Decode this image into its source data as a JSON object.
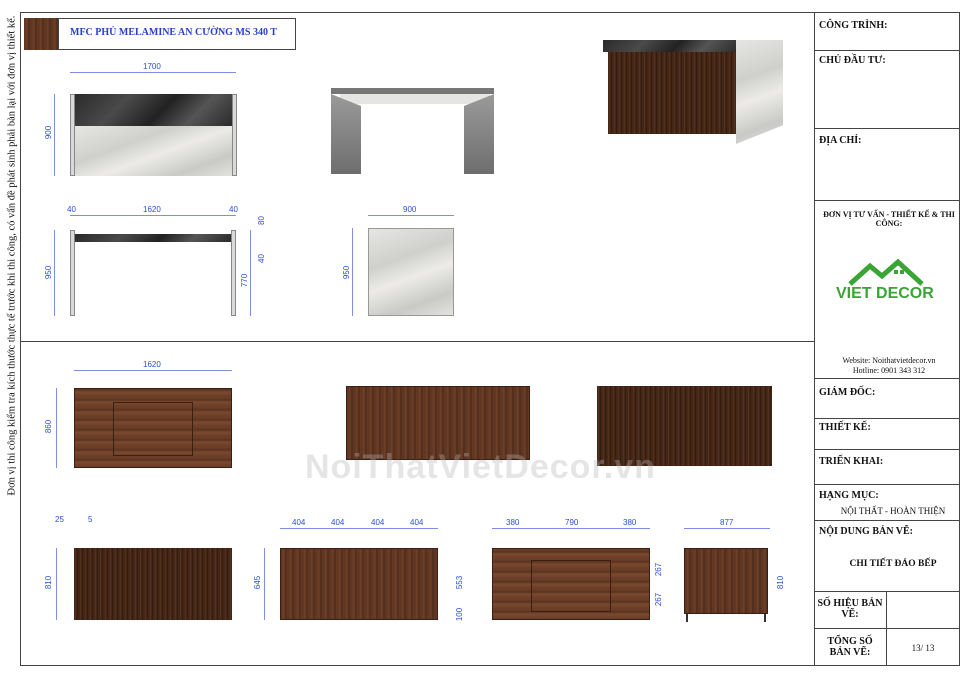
{
  "side_note": "Đơn vị thi công kiểm tra kích thước thực tế trước khi thi công, có vấn đề phát sinh phải bàn lại với đơn vị thiết kế.",
  "material_label": "MFC PHỦ MELAMINE AN CƯỜNG MS 340 T",
  "watermark": "NoiThatVietDecor.vn",
  "dims": {
    "d1700": "1700",
    "d900a": "900",
    "d40a": "40",
    "d1620a": "1620",
    "d40b": "40",
    "d80": "80",
    "d40c": "40",
    "d950a": "950",
    "d770": "770",
    "d900b": "900",
    "d950b": "950",
    "d1620b": "1620",
    "d860": "860",
    "d25": "25",
    "d5": "5",
    "d810a": "810",
    "d404a": "404",
    "d404b": "404",
    "d404c": "404",
    "d404d": "404",
    "d645": "645",
    "d380a": "380",
    "d790": "790",
    "d380b": "380",
    "d553": "553",
    "d100": "100",
    "d267a": "267",
    "d267b": "267",
    "d877": "877",
    "d810b": "810"
  },
  "title_block": {
    "cong_trinh": "CÔNG TRÌNH:",
    "chu_dau_tu": "CHỦ ĐẦU TƯ:",
    "dia_chi": "ĐỊA CHỈ:",
    "don_vi": "ĐƠN VỊ TƯ VẤN - THIẾT KẾ & THI CÔNG:",
    "logo_text": "VIET DECOR",
    "website": "Website: Noithatvietdecor.vn",
    "hotline": "Hotline: 0901 343 312",
    "giam_doc": "GIÁM ĐỐC:",
    "thiet_ke": "THIẾT KẾ:",
    "trien_khai": "TRIỂN KHAI:",
    "hang_muc": "HẠNG MỤC:",
    "hang_muc_value": "NỘI THẤT - HOÀN THIỆN",
    "noi_dung": "NỘI DUNG BẢN VẼ:",
    "noi_dung_value": "CHI TIẾT ĐẢO BẾP",
    "so_hieu": "SỐ HIỆU BẢN VẼ:",
    "tong_so": "TỔNG SỐ BẢN VẼ:",
    "tong_so_value": "13/ 13"
  },
  "colors": {
    "dimension": "#2b4fd6",
    "logo_green": "#3aa535",
    "logo_red": "#d1342b"
  }
}
